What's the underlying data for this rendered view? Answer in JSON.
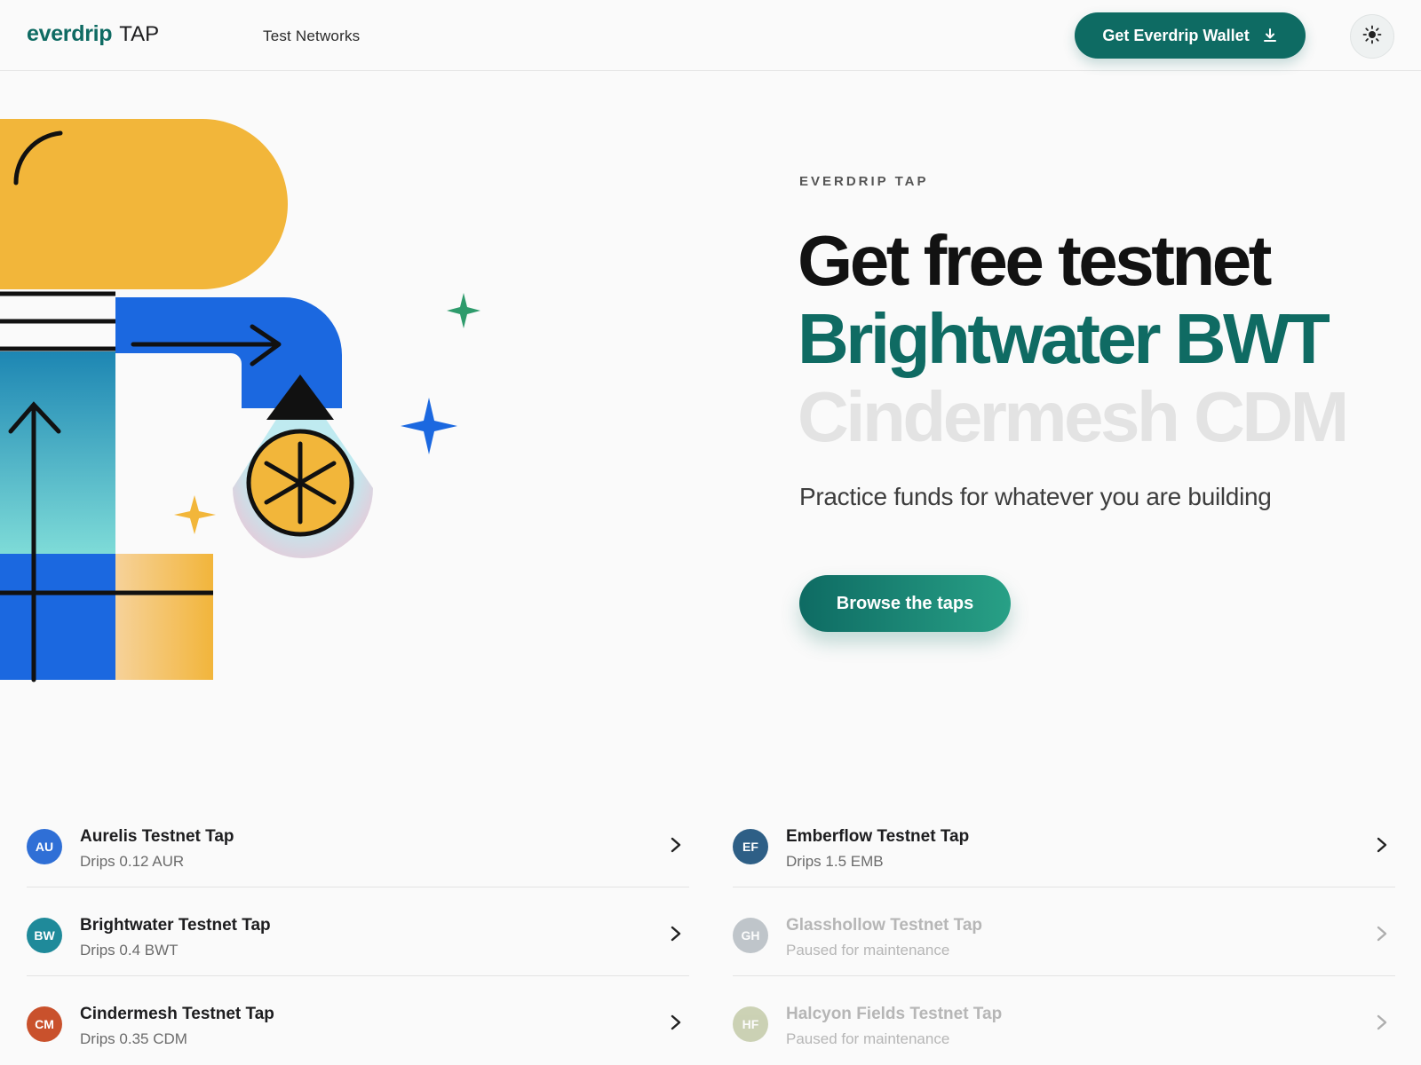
{
  "header": {
    "logo_brand": "everdrip",
    "logo_suffix": "TAP",
    "nav_link": "Test Networks",
    "wallet_button": "Get Everdrip Wallet",
    "wallet_icon": "download-icon",
    "theme_icon": "sun-icon"
  },
  "hero": {
    "eyebrow": "EVERDRIP TAP",
    "title_line1": "Get free testnet",
    "title_line2": "Brightwater BWT",
    "title_line3": "Cindermesh CDM",
    "subtitle": "Practice funds for whatever you are building",
    "cta": "Browse the taps",
    "colors": {
      "accent": "#0f6b63",
      "muted": "#e3e3e3"
    }
  },
  "taps": {
    "left": [
      {
        "initials": "AU",
        "name": "Aurelis Testnet Tap",
        "sub": "Drips 0.12 AUR",
        "color": "#2f6fd6",
        "paused": false
      },
      {
        "initials": "BW",
        "name": "Brightwater Testnet Tap",
        "sub": "Drips 0.4 BWT",
        "color": "#1f8a9a",
        "paused": false
      },
      {
        "initials": "CM",
        "name": "Cindermesh Testnet Tap",
        "sub": "Drips 0.35 CDM",
        "color": "#c9512c",
        "paused": false
      }
    ],
    "right": [
      {
        "initials": "EF",
        "name": "Emberflow Testnet Tap",
        "sub": "Drips 1.5 EMB",
        "color": "#2e5f86",
        "paused": false
      },
      {
        "initials": "GH",
        "name": "Glasshollow Testnet Tap",
        "sub": "Paused for maintenance",
        "color": "#8f9aa3",
        "paused": true
      },
      {
        "initials": "HF",
        "name": "Halcyon Fields Testnet Tap",
        "sub": "Paused for maintenance",
        "color": "#a5b07c",
        "paused": true
      }
    ]
  }
}
